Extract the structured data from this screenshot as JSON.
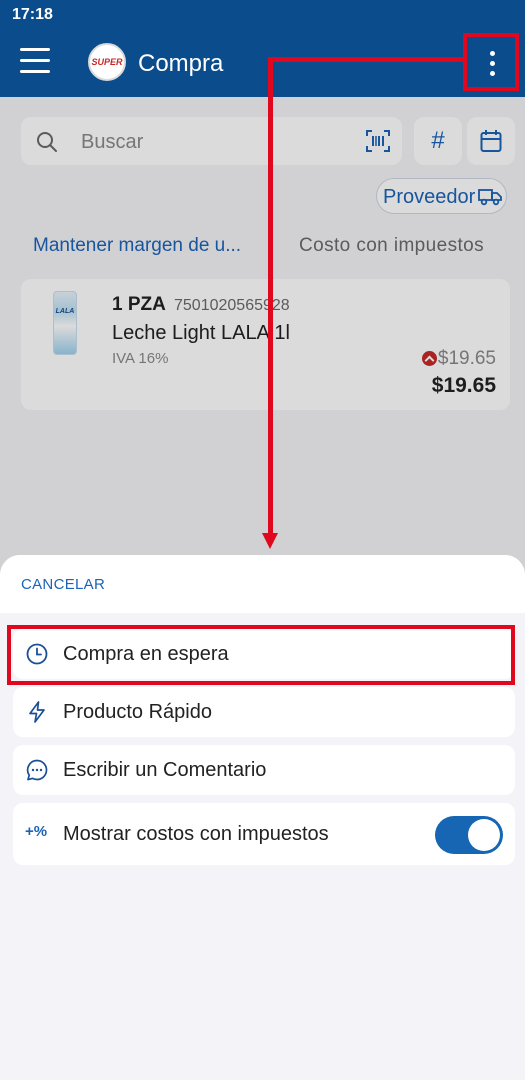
{
  "status_bar": {
    "time": "17:18"
  },
  "app_bar": {
    "title": "Compra",
    "logo_text": "SUPER"
  },
  "search": {
    "placeholder": "Buscar",
    "hash_label": "#"
  },
  "supplier": {
    "label": "Proveedor"
  },
  "columns": {
    "margin": "Mantener margen de u...",
    "cost": "Costo con impuestos"
  },
  "product": {
    "quantity": "1 PZA",
    "code": "7501020565928",
    "name": "Leche Light LALA 1l",
    "tax": "IVA 16%",
    "old_price": "$19.65",
    "price": "$19.65",
    "thumb_label": "LALA"
  },
  "sheet": {
    "cancel": "CANCELAR",
    "options": [
      {
        "label": "Compra en espera",
        "icon": "clock-icon"
      },
      {
        "label": "Producto Rápido",
        "icon": "bolt-icon"
      },
      {
        "label": "Escribir un Comentario",
        "icon": "comment-icon"
      },
      {
        "label": "Mostrar costos con impuestos",
        "icon": "percent-icon",
        "icon_text": "+%",
        "toggle_on": true
      }
    ]
  },
  "colors": {
    "primary": "#0b4c8c",
    "accent": "#1b63b7",
    "annotation": "#e0081f"
  }
}
